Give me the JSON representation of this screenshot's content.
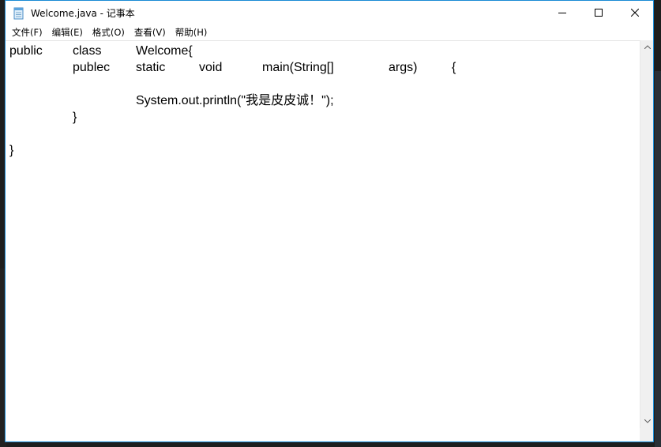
{
  "window": {
    "title": "Welcome.java - 记事本",
    "controls": {
      "minimize": "minimize-icon",
      "maximize": "maximize-icon",
      "close": "close-icon"
    }
  },
  "menu": {
    "items": [
      "文件(F)",
      "编辑(E)",
      "格式(O)",
      "查看(V)",
      "帮助(H)"
    ]
  },
  "editor": {
    "tokens": {
      "l1_public": "public",
      "l1_class": "class",
      "l1_welcome": "Welcome{",
      "l2_publec": "publec",
      "l2_static": "static",
      "l2_void": "void",
      "l2_main": "main(String[]",
      "l2_args": "args)",
      "l2_brace": "{",
      "l4_print": "System.out.println(\"我是皮皮诚！\");",
      "l5_close": "}",
      "l7_close": "}"
    }
  },
  "colors": {
    "accent": "#1a8ad4",
    "background": "#ffffff",
    "text": "#000000"
  }
}
